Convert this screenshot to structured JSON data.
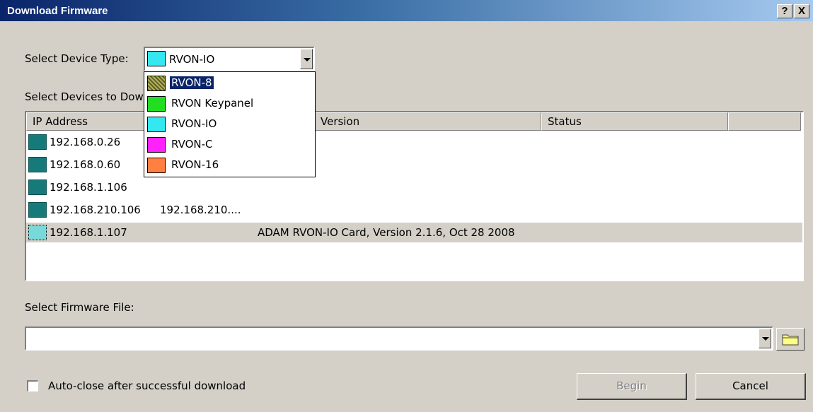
{
  "window": {
    "title": "Download Firmware",
    "help_glyph": "?",
    "close_glyph": "X"
  },
  "device_type": {
    "label": "Select Device Type:",
    "selected": "RVON-IO",
    "selected_color": "#33e8f0",
    "options": [
      {
        "label": "RVON-8",
        "color": "#808040",
        "selected": true
      },
      {
        "label": "RVON Keypanel",
        "color": "#22dd22"
      },
      {
        "label": "RVON-IO",
        "color": "#33e8f0"
      },
      {
        "label": "RVON-C",
        "color": "#ff22ff"
      },
      {
        "label": "RVON-16",
        "color": "#ff8040"
      }
    ]
  },
  "devices": {
    "label": "Select Devices to Dow",
    "columns": [
      "IP Address",
      "Version",
      "Status",
      ""
    ],
    "rows": [
      {
        "ip": "192.168.0.26",
        "name": "",
        "version": "",
        "status": ""
      },
      {
        "ip": "192.168.0.60",
        "name": "",
        "version": "",
        "status": ""
      },
      {
        "ip": "192.168.1.106",
        "name": "",
        "version": "",
        "status": ""
      },
      {
        "ip": "192.168.210.106",
        "name": "192.168.210....",
        "version": "",
        "status": ""
      },
      {
        "ip": "192.168.1.107",
        "name": "",
        "version": "ADAM RVON-IO Card, Version 2.1.6, Oct 28 2008",
        "status": "",
        "selected": true
      }
    ],
    "icon_color": "#167a7a"
  },
  "firmware": {
    "label": "Select Firmware File:",
    "value": ""
  },
  "auto_close": {
    "label": "Auto-close after successful download",
    "checked": false
  },
  "buttons": {
    "begin": "Begin",
    "cancel": "Cancel"
  }
}
